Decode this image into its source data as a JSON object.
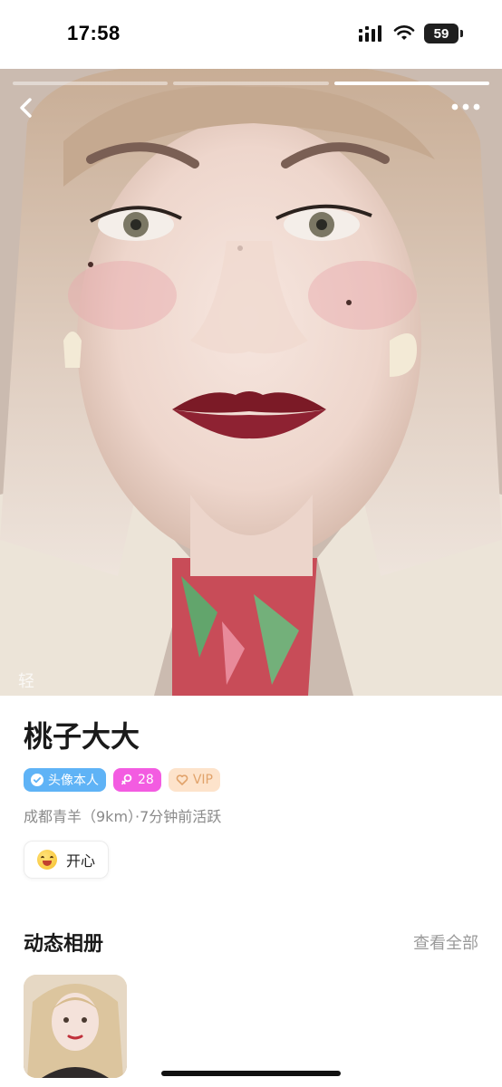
{
  "status_bar": {
    "time": "17:58",
    "battery": "59",
    "icons": [
      "signal-icon",
      "wifi-icon",
      "battery-icon"
    ]
  },
  "photo": {
    "slides_total": 3,
    "active_slide": 3,
    "watermark": "轻"
  },
  "profile": {
    "name": "桃子大大",
    "tags": {
      "verified": "头像本人",
      "age": "28",
      "vip": "VIP"
    },
    "location": "成都青羊（9km）·7分钟前活跃",
    "mood": "开心"
  },
  "album": {
    "title": "动态相册",
    "view_all": "查看全部"
  },
  "colors": {
    "verified": "#5fb3f6",
    "age": "#f35ce1",
    "vip_bg": "#fde3cb",
    "vip_text": "#e1a36b"
  }
}
